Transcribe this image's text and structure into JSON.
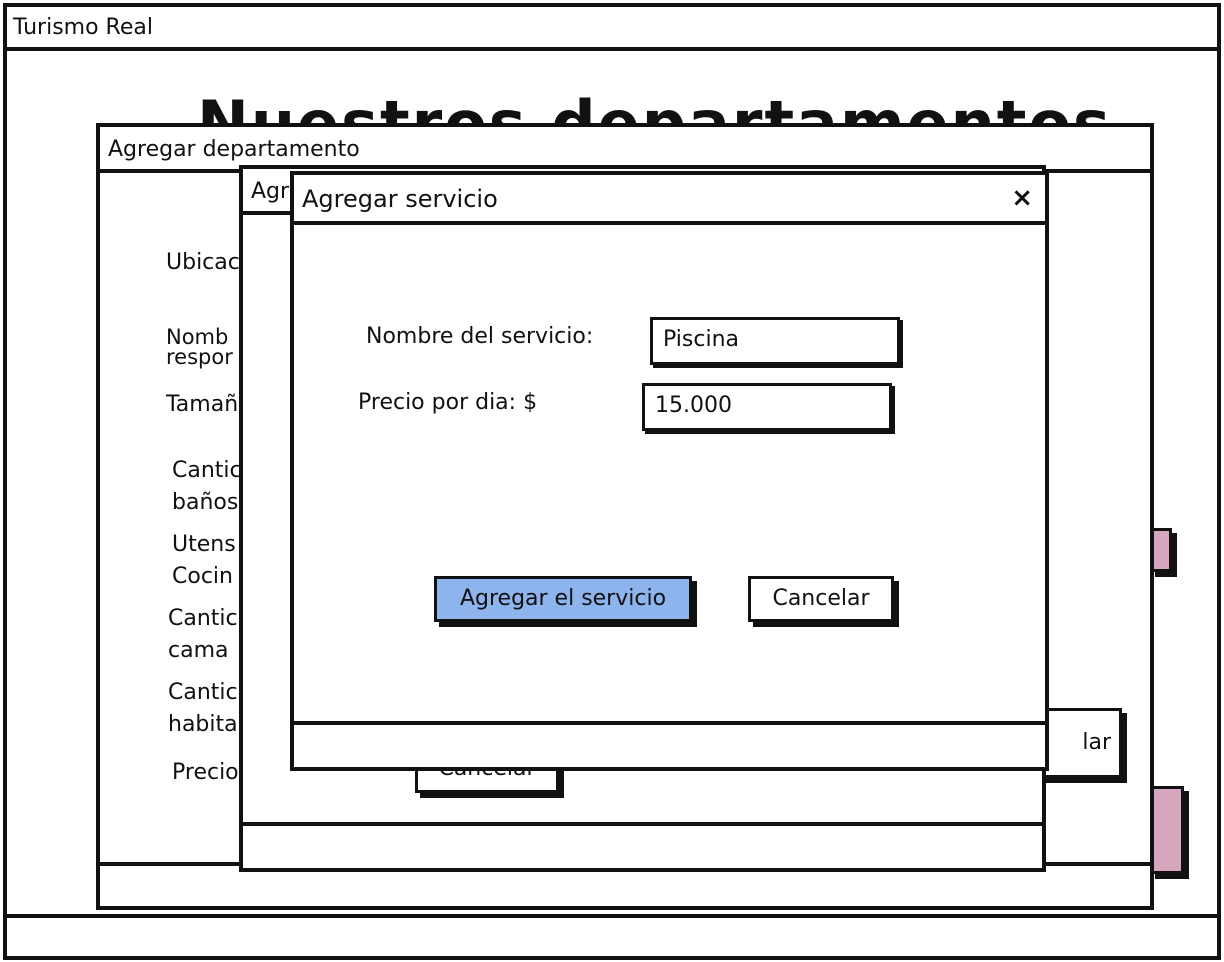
{
  "app": {
    "title": "Turismo Real",
    "heading": "Nuestros departamentos"
  },
  "dialog_departamento": {
    "title": "Agregar departamento",
    "labels": [
      "Ubicac",
      "Nomb\nrespor",
      "Tamañ",
      "Cantic\nbaños",
      "Utens\nCocin",
      "Cantic\ncama",
      "Cantic\nhabita",
      "Precio"
    ],
    "cancel_partial": "lar"
  },
  "dialog_middle": {
    "title_partial": "Agr",
    "cancel_label": "Cancelar"
  },
  "dialog_servicio": {
    "title": "Agregar servicio",
    "close_icon": "×",
    "fields": {
      "nombre_label": "Nombre del servicio:",
      "nombre_value": "Piscina",
      "precio_label": "Precio por dia: $",
      "precio_value": "15.000"
    },
    "buttons": {
      "add": "Agregar el servicio",
      "cancel": "Cancelar"
    }
  },
  "colors": {
    "accent_button": "#8eb4ee",
    "pink_button": "#d5a6bd",
    "border": "#111111"
  }
}
